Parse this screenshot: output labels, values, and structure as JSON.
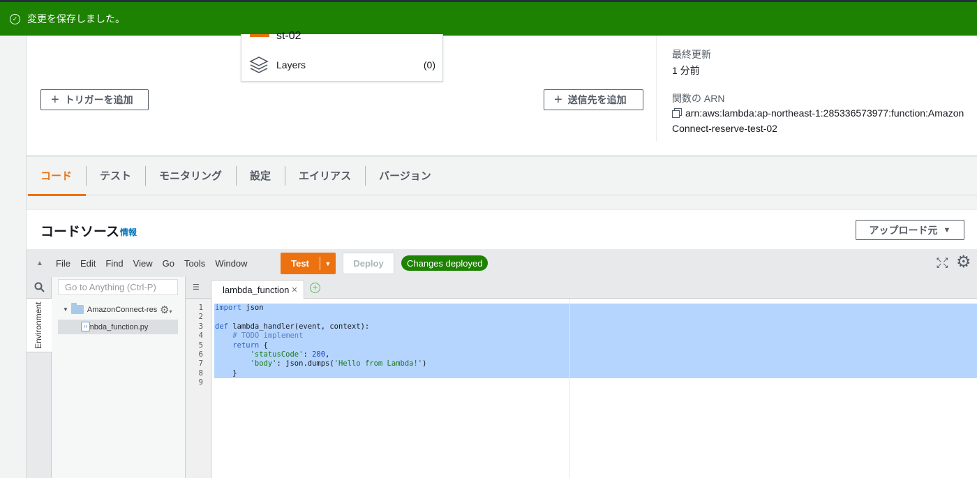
{
  "flash": {
    "message": "変更を保存しました。"
  },
  "function_card": {
    "name": "st-02",
    "layers_label": "Layers",
    "layers_count": "(0)"
  },
  "overview": {
    "add_trigger_label": "トリガーを追加",
    "add_destination_label": "送信先を追加",
    "last_modified_label": "最終更新",
    "last_modified_value": "1 分前",
    "arn_label": "関数の ARN",
    "arn_line1": "arn:aws:lambda:ap-northeast-1:285336573977:function:Amazon",
    "arn_line2": "Connect-reserve-test-02"
  },
  "tabs": [
    "コード",
    "テスト",
    "モニタリング",
    "設定",
    "エイリアス",
    "バージョン"
  ],
  "code_source": {
    "title": "コードソース",
    "info_link": "情報",
    "upload_label": "アップロード元"
  },
  "ide": {
    "menu": [
      "File",
      "Edit",
      "Find",
      "View",
      "Go",
      "Tools",
      "Window"
    ],
    "test_label": "Test",
    "deploy_label": "Deploy",
    "status_badge": "Changes deployed",
    "goto_placeholder": "Go to Anything (Ctrl-P)",
    "environment_label": "Environment",
    "folder_name": "AmazonConnect-res",
    "file_name": "lambda_function.py",
    "open_tab": "lambda_function",
    "code_lines": [
      "import json",
      "",
      "def lambda_handler(event, context):",
      "    # TODO implement",
      "    return {",
      "        'statusCode': 200,",
      "        'body': json.dumps('Hello from Lambda!')",
      "    }",
      ""
    ],
    "line_numbers": [
      "1",
      "2",
      "3",
      "4",
      "5",
      "6",
      "7",
      "8",
      "9"
    ]
  },
  "colors": {
    "success": "#1d8102",
    "accent": "#ec7211",
    "link": "#0073bb",
    "selection": "#b5d5ff"
  }
}
